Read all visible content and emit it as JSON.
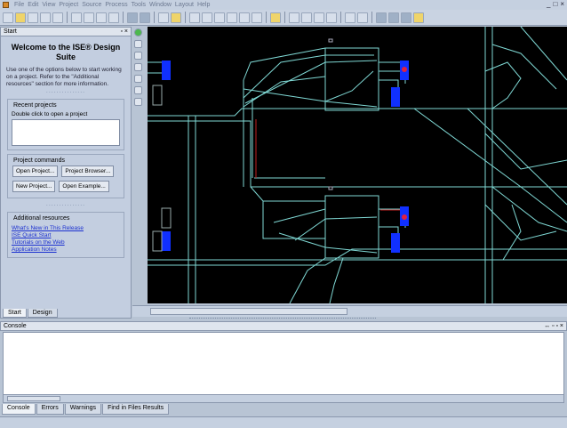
{
  "menu": {
    "items": [
      "File",
      "Edit",
      "View",
      "Project",
      "Source",
      "Process",
      "Tools",
      "Window",
      "Layout",
      "Help"
    ]
  },
  "window_controls": [
    "_",
    "□",
    "×"
  ],
  "start_panel": {
    "title": "Start",
    "heading": "Welcome to the ISE® Design Suite",
    "intro": "Use one of the options below to start working on a project. Refer to the \"Additional resources\" section for more information.",
    "separator": "...............",
    "recent": {
      "title": "Recent projects",
      "hint": "Double click to open a project"
    },
    "commands": {
      "title": "Project commands",
      "open_project": "Open Project...",
      "project_browser": "Project Browser...",
      "new_project": "New Project...",
      "open_example": "Open Example..."
    },
    "resources": {
      "title": "Additional resources",
      "links": [
        "What's New in This Release",
        "ISE Quick Start",
        "Tutorials on the Web",
        "Application Notes"
      ]
    },
    "tabs": [
      "Start",
      "Design"
    ],
    "pin": "▫",
    "close": "×"
  },
  "console": {
    "title": "Console",
    "controls": "↔ ▫ ▫ ×",
    "tabs": [
      "Console",
      "Errors",
      "Warnings",
      "Find in Files Results"
    ]
  },
  "colors": {
    "trace": "#7fd8d4",
    "pad": "#1030ff",
    "pad_dot": "#e02040",
    "red": "#c02020",
    "bg": "#000000"
  }
}
